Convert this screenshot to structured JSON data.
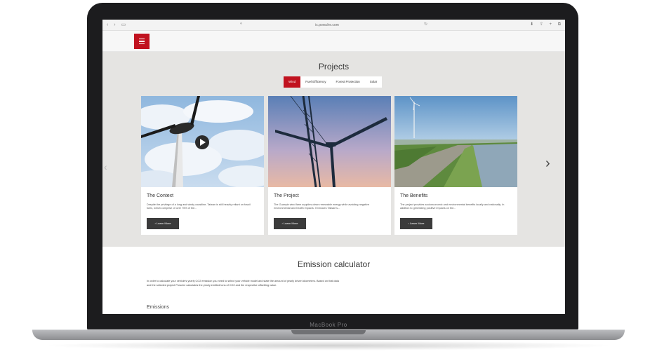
{
  "browser": {
    "url": "ic.porsche.com",
    "nav_icons": [
      "back-icon",
      "forward-icon",
      "sidebar-icon"
    ],
    "right_icons": [
      "share-icon",
      "add-tab-icon",
      "tabs-icon"
    ]
  },
  "header": {
    "menu_icon": "hamburger-icon",
    "accent_color": "#c1121f"
  },
  "projects": {
    "title": "Projects",
    "tabs": [
      {
        "label": "Wind",
        "active": true
      },
      {
        "label": "Fuel Efficiency",
        "active": false
      },
      {
        "label": "Forest Protection",
        "active": false
      },
      {
        "label": "Solar",
        "active": false
      }
    ],
    "cards": [
      {
        "title": "The Context",
        "description": "Despite the privilege of a long and windy coastline, Taiwan is still heavily reliant on fossil fuels, which comprise of over 75% of the...",
        "button": "Learn More",
        "has_video": true
      },
      {
        "title": "The Project",
        "description": "The Guanyin wind farm supplies clean renewable energy while avoiding negative environmental and health impacts. It reduces Taiwan's...",
        "button": "Learn More",
        "has_video": false
      },
      {
        "title": "The Benefits",
        "description": "The project provides socioeconomic and environmental benefits locally and nationally. In addition to generating positive impacts on the...",
        "button": "Learn More",
        "has_video": false
      }
    ]
  },
  "calculator": {
    "title": "Emission calculator",
    "text": "In order to calculate your vehicle's yearly CO2 emission you need to select your vehicle model and state the amount of yearly driven kilometers. Based on that data and the selected project Porsche calculates the yearly emitted tons of CO2 and the respective offsetting value.",
    "subtitle": "Emissions"
  },
  "device": {
    "label": "MacBook Pro"
  }
}
